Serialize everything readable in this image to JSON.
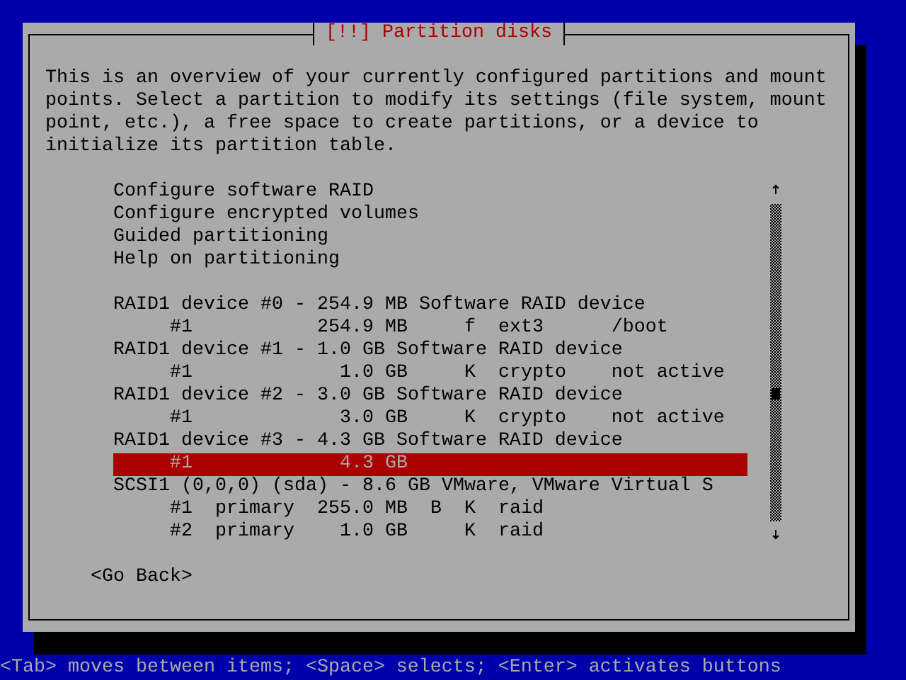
{
  "dialog": {
    "title": "[!!] Partition disks",
    "description": "This is an overview of your currently configured partitions and mount points. Select a partition to modify its settings (file system, mount point, etc.), a free space to create partitions, or a device to initialize its partition table.",
    "actions": [
      {
        "text": "Configure software RAID",
        "selected": false
      },
      {
        "text": "Configure encrypted volumes",
        "selected": false
      },
      {
        "text": "Guided partitioning",
        "selected": false
      },
      {
        "text": "Help on partitioning",
        "selected": false
      }
    ],
    "devices": [
      {
        "text": "RAID1 device #0 - 254.9 MB Software RAID device",
        "selected": false,
        "children": [
          {
            "text": "#1           254.9 MB     f  ext3      /boot",
            "selected": false
          }
        ]
      },
      {
        "text": "RAID1 device #1 - 1.0 GB Software RAID device",
        "selected": false,
        "children": [
          {
            "text": "#1             1.0 GB     K  crypto    not active",
            "selected": false
          }
        ]
      },
      {
        "text": "RAID1 device #2 - 3.0 GB Software RAID device",
        "selected": false,
        "children": [
          {
            "text": "#1             3.0 GB     K  crypto    not active",
            "selected": false
          }
        ]
      },
      {
        "text": "RAID1 device #3 - 4.3 GB Software RAID device",
        "selected": false,
        "children": [
          {
            "text": "#1             4.3 GB",
            "selected": true
          }
        ]
      },
      {
        "text": "SCSI1 (0,0,0) (sda) - 8.6 GB VMware, VMware Virtual S",
        "selected": false,
        "children": [
          {
            "text": "#1  primary  255.0 MB  B  K  raid",
            "selected": false
          },
          {
            "text": "#2  primary    1.0 GB     K  raid",
            "selected": false
          }
        ]
      }
    ],
    "buttons": [
      "<Go Back>"
    ]
  },
  "status_bar": "<Tab> moves between items; <Space> selects; <Enter> activates buttons"
}
